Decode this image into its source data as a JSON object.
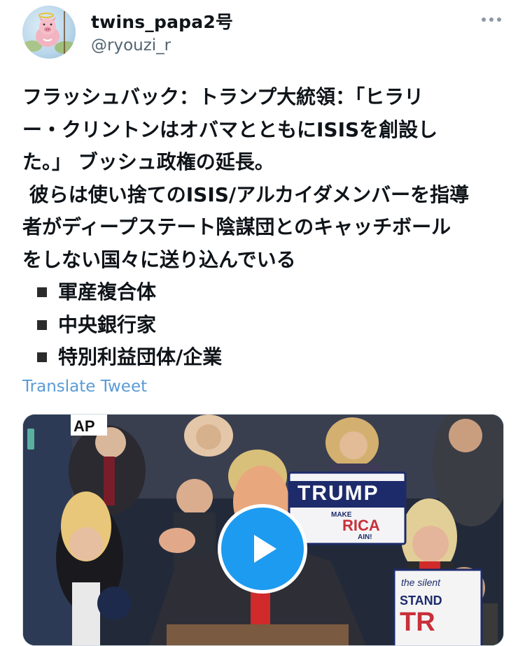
{
  "tweet": {
    "author": {
      "display_name": "twins_papa2号",
      "handle": "@ryouzi_r",
      "avatar_icon": "pig-avatar-icon"
    },
    "more_icon": "more-options-icon",
    "lines": [
      "フラッシュバック：トランプ大統領：「ヒラリ",
      "ー・クリントンはオバマとともにISISを創設し",
      "た。」 ブッシュ政権の延長。",
      " 彼らは使い捨てのISIS/アルカイダメンバーを指導",
      "者がディープステート陰謀団とのキャッチボール",
      "をしない国々に送り込んでいる"
    ],
    "bullets": [
      "軍産複合体",
      "中央銀行家",
      "特別利益団体/企業"
    ],
    "translate_label": "Translate Tweet",
    "media": {
      "type": "video",
      "play_icon": "play-icon",
      "sign_main": "TRUMP",
      "sign_sub_1": "MAKE",
      "sign_sub_2": "RICA",
      "sign_sub_3": "AIN!",
      "sign_corner": "AP",
      "sign_right_1": "the silent",
      "sign_right_2": "STAND",
      "sign_right_3": "TR"
    }
  },
  "colors": {
    "link": "#5a9bd6",
    "handle": "#536471",
    "play_button": "#1d9bf0"
  }
}
